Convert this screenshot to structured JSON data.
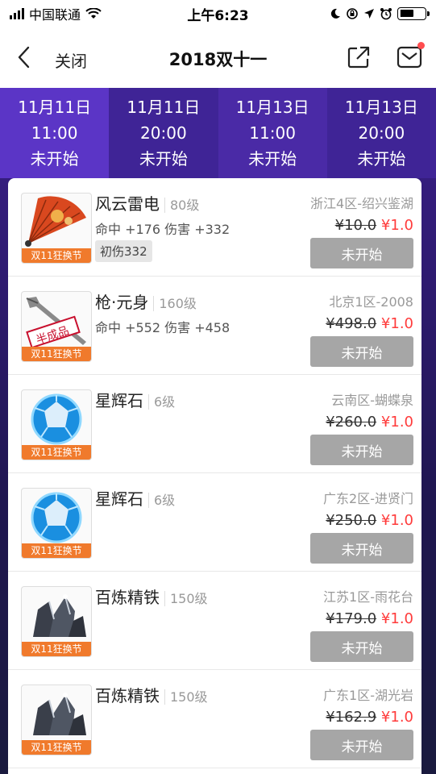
{
  "status_bar": {
    "carrier": "中国联通",
    "time": "上午6:23"
  },
  "nav": {
    "close_label": "关闭",
    "title": "2018双十一"
  },
  "tabs": [
    {
      "date": "11月11日",
      "time": "11:00",
      "status": "未开始",
      "active": true
    },
    {
      "date": "11月11日",
      "time": "20:00",
      "status": "未开始",
      "active": false
    },
    {
      "date": "11月13日",
      "time": "11:00",
      "status": "未开始",
      "active": false
    },
    {
      "date": "11月13日",
      "time": "20:00",
      "status": "未开始",
      "active": false
    }
  ],
  "items": [
    {
      "name": "风云雷电",
      "level": "80级",
      "stats": "命中 +176 伤害 +332",
      "badge": "初伤332",
      "server": "浙江4区-绍兴鉴湖",
      "old_price": "¥10.0",
      "new_price": "¥1.0",
      "tag": "双11狂换节",
      "button": "未开始",
      "icon": "fan-icon"
    },
    {
      "name": "枪·元身",
      "level": "160级",
      "stats": "命中 +552 伤害 +458",
      "badge": "",
      "server": "北京1区-2008",
      "old_price": "¥498.0",
      "new_price": "¥1.0",
      "tag": "双11狂换节",
      "button": "未开始",
      "icon": "spear-icon",
      "stamp": "半成品"
    },
    {
      "name": "星辉石",
      "level": "6级",
      "stats": "",
      "badge": "",
      "server": "云南区-蝴蝶泉",
      "old_price": "¥260.0",
      "new_price": "¥1.0",
      "tag": "双11狂换节",
      "button": "未开始",
      "icon": "blue-gem-icon"
    },
    {
      "name": "星辉石",
      "level": "6级",
      "stats": "",
      "badge": "",
      "server": "广东2区-进贤门",
      "old_price": "¥250.0",
      "new_price": "¥1.0",
      "tag": "双11狂换节",
      "button": "未开始",
      "icon": "blue-gem-icon"
    },
    {
      "name": "百炼精铁",
      "level": "150级",
      "stats": "",
      "badge": "",
      "server": "江苏1区-雨花台",
      "old_price": "¥179.0",
      "new_price": "¥1.0",
      "tag": "双11狂换节",
      "button": "未开始",
      "icon": "iron-ore-icon"
    },
    {
      "name": "百炼精铁",
      "level": "150级",
      "stats": "",
      "badge": "",
      "server": "广东1区-湖光岩",
      "old_price": "¥162.9",
      "new_price": "¥1.0",
      "tag": "双11狂换节",
      "button": "未开始",
      "icon": "iron-ore-icon"
    }
  ]
}
